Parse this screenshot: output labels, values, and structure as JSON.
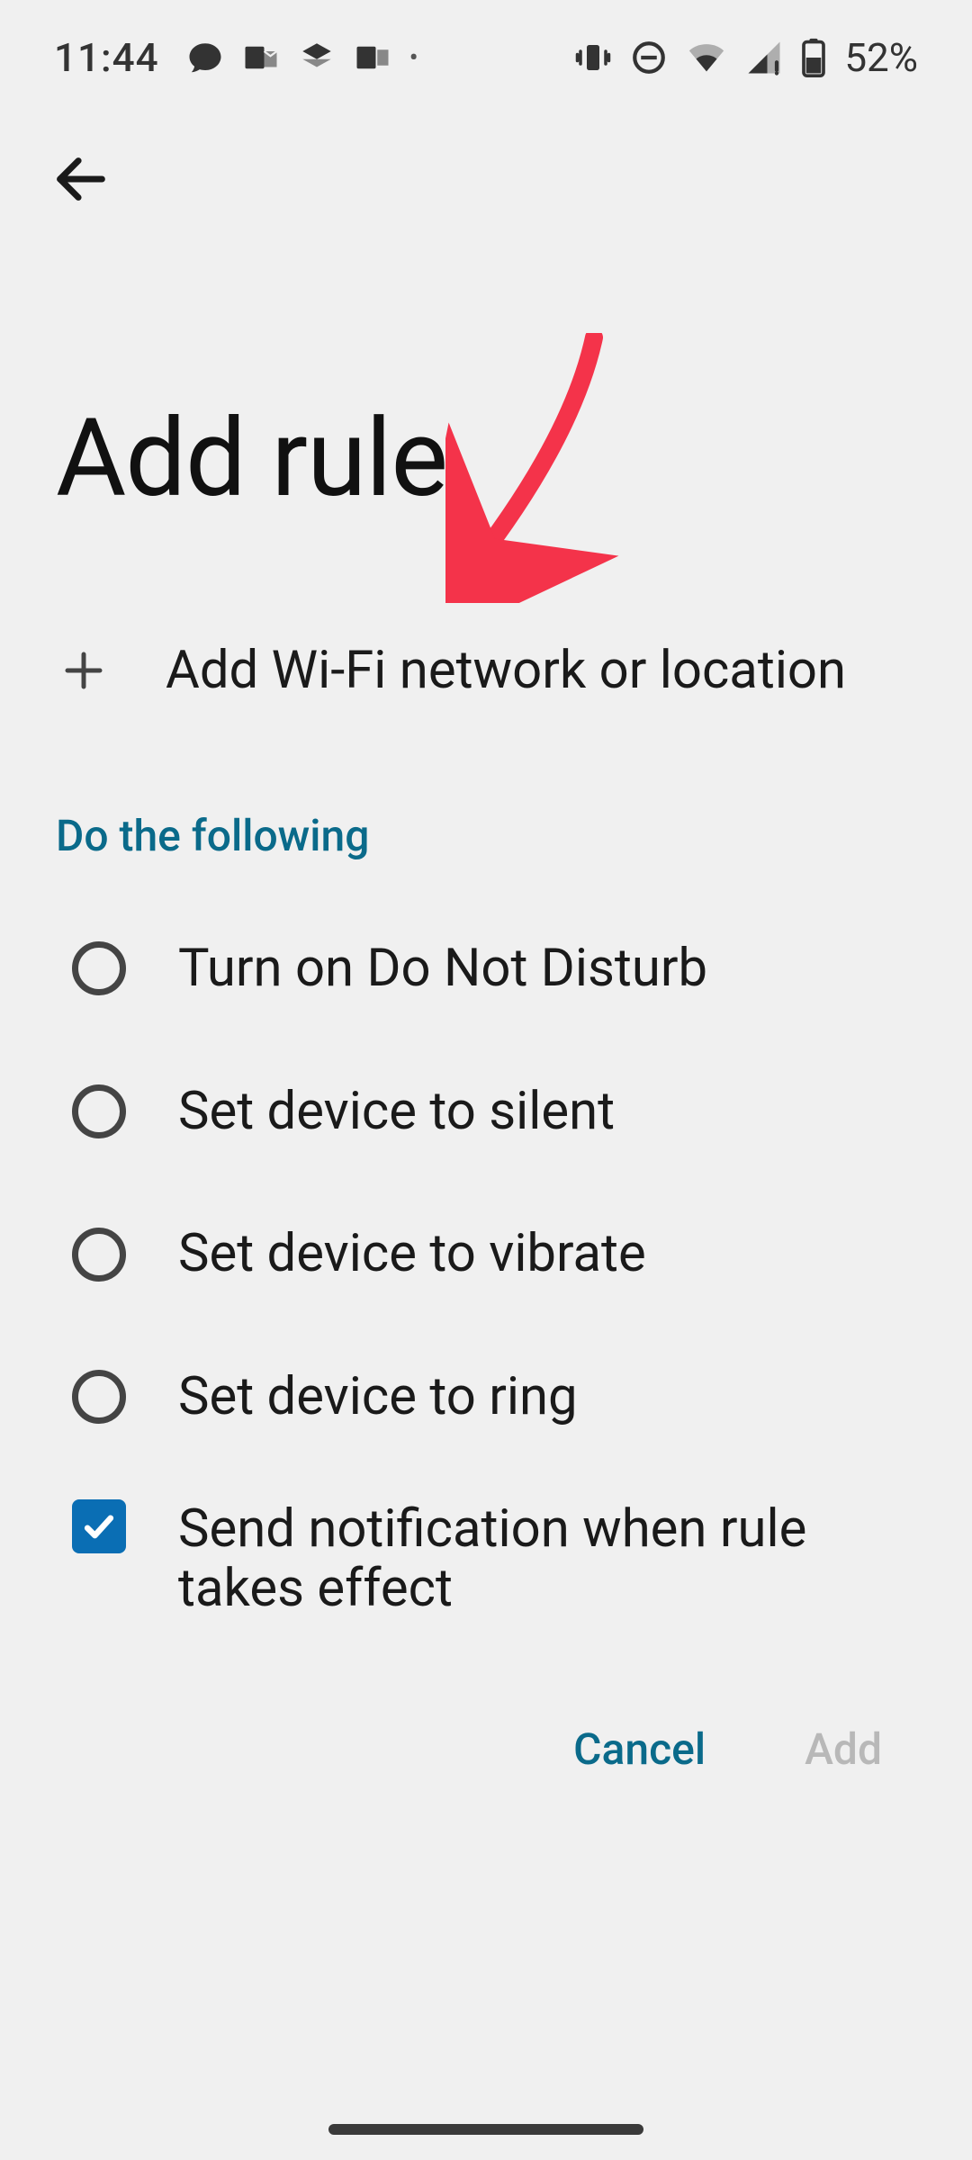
{
  "status_bar": {
    "time": "11:44",
    "battery_text": "52%"
  },
  "page": {
    "title": "Add rule",
    "add_network_label": "Add Wi-Fi network or location",
    "section_header": "Do the following"
  },
  "options": [
    {
      "label": "Turn on Do Not Disturb",
      "selected": false
    },
    {
      "label": "Set device to silent",
      "selected": false
    },
    {
      "label": "Set device to vibrate",
      "selected": false
    },
    {
      "label": "Set device to ring",
      "selected": false
    }
  ],
  "notify": {
    "label": "Send notification when rule takes effect",
    "checked": true
  },
  "actions": {
    "cancel": "Cancel",
    "add": "Add"
  }
}
